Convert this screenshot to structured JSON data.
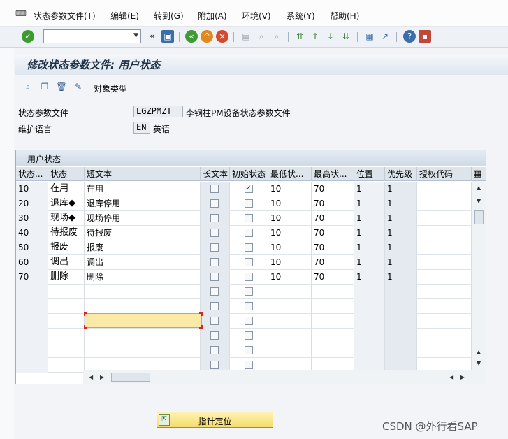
{
  "menu": {
    "items": [
      "状态参数文件(T)",
      "编辑(E)",
      "转到(G)",
      "附加(A)",
      "环境(V)",
      "系统(Y)",
      "帮助(H)"
    ]
  },
  "toolbar": {
    "command_value": "",
    "icons": [
      "enter-icon",
      "save-icon",
      "back-icon",
      "exit-icon",
      "cancel-icon",
      "print-icon",
      "find-icon",
      "find-next-icon",
      "first-page-icon",
      "prev-page-icon",
      "next-page-icon",
      "last-page-icon",
      "new-session-icon",
      "shortcut-icon",
      "help-icon",
      "layout-icon"
    ]
  },
  "title": "修改状态参数文件: 用户状态",
  "app_toolbar": {
    "object_type_label": "对象类型"
  },
  "header": {
    "profile_label": "状态参数文件",
    "profile_value": "LGZPMZT",
    "profile_desc": "李钢柱PM设备状态参数文件",
    "lang_label": "维护语言",
    "lang_value": "EN",
    "lang_desc": "英语"
  },
  "table": {
    "title": "用户状态",
    "columns": [
      "状态...",
      "状态",
      "短文本",
      "长文本",
      "初始状态",
      "最低状...",
      "最高状...",
      "位置",
      "优先级",
      "授权代码"
    ],
    "rows": [
      {
        "no": "10",
        "status": "在用",
        "text": "在用",
        "long": false,
        "init": true,
        "low": "10",
        "high": "70",
        "pos": "1",
        "prio": "1",
        "auth": ""
      },
      {
        "no": "20",
        "status": "退库◆",
        "text": "退库停用",
        "long": false,
        "init": false,
        "low": "10",
        "high": "70",
        "pos": "1",
        "prio": "1",
        "auth": ""
      },
      {
        "no": "30",
        "status": "现场◆",
        "text": "现场停用",
        "long": false,
        "init": false,
        "low": "10",
        "high": "70",
        "pos": "1",
        "prio": "1",
        "auth": ""
      },
      {
        "no": "40",
        "status": "待报废",
        "text": "待报废",
        "long": false,
        "init": false,
        "low": "10",
        "high": "70",
        "pos": "1",
        "prio": "1",
        "auth": ""
      },
      {
        "no": "50",
        "status": "报废",
        "text": "报废",
        "long": false,
        "init": false,
        "low": "10",
        "high": "70",
        "pos": "1",
        "prio": "1",
        "auth": ""
      },
      {
        "no": "60",
        "status": "调出",
        "text": "调出",
        "long": false,
        "init": false,
        "low": "10",
        "high": "70",
        "pos": "1",
        "prio": "1",
        "auth": ""
      },
      {
        "no": "70",
        "status": "删除",
        "text": "删除",
        "long": false,
        "init": false,
        "low": "10",
        "high": "70",
        "pos": "1",
        "prio": "1",
        "auth": ""
      }
    ],
    "empty_rows": 6
  },
  "bottom_button": {
    "label": "指针定位"
  },
  "watermark": "CSDN @外行看SAP"
}
